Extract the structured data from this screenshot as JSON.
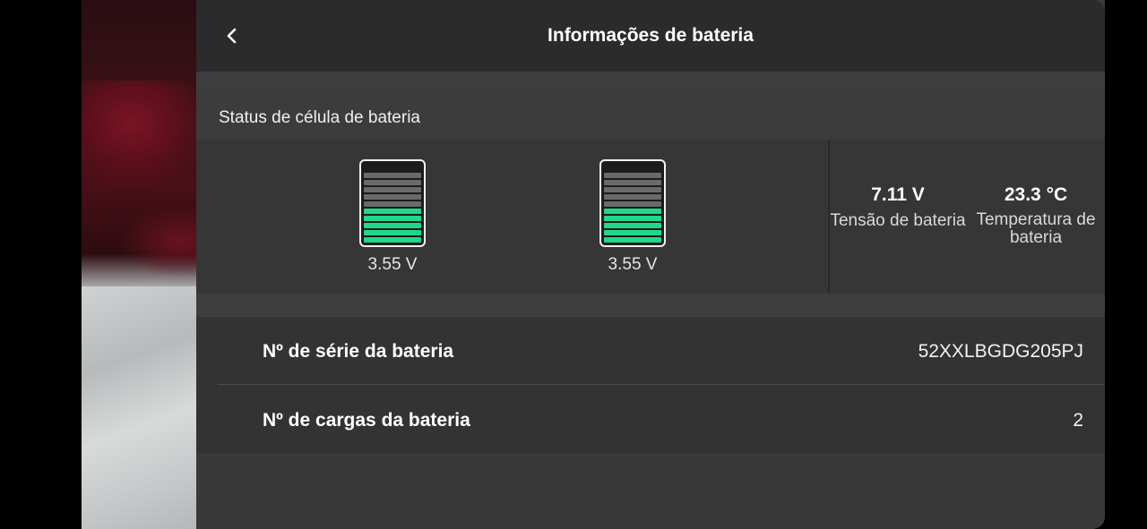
{
  "header": {
    "title": "Informações de bateria",
    "back_icon": "chevron-left-icon"
  },
  "section": {
    "title": "Status de célula de bateria"
  },
  "cells": [
    {
      "voltage": "3.55 V",
      "level_fraction": 0.5
    },
    {
      "voltage": "3.55 V",
      "level_fraction": 0.5
    }
  ],
  "stats": {
    "voltage": {
      "value": "7.11 V",
      "label": "Tensão de bateria"
    },
    "temperature": {
      "value": "23.3 °C",
      "label": "Temperatura de bateria"
    }
  },
  "info": {
    "serial": {
      "label": "Nº de série da bateria",
      "value": "52XXLBGDG205PJ"
    },
    "charges": {
      "label": "Nº de cargas da bateria",
      "value": "2"
    }
  },
  "colors": {
    "accent_green": "#1fd88a",
    "panel_bg": "#3a3a3a",
    "header_bg": "#2b2b2b"
  }
}
